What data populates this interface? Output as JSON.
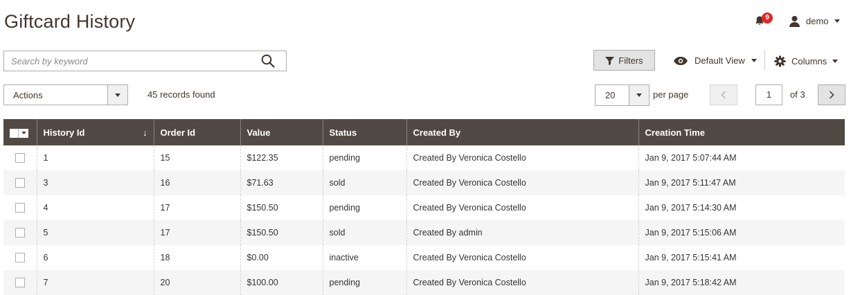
{
  "header": {
    "title": "Giftcard History",
    "notifications_count": "9",
    "user_name": "demo"
  },
  "search": {
    "placeholder": "Search by keyword",
    "value": ""
  },
  "toolbar": {
    "filters_label": "Filters",
    "view_label": "Default View",
    "columns_label": "Columns"
  },
  "actions": {
    "label": "Actions",
    "records_found": "45 records found"
  },
  "pagination": {
    "per_page_value": "20",
    "per_page_label": "per page",
    "current_page": "1",
    "total_pages_text": "of 3"
  },
  "icons": {
    "bell": "bell-icon",
    "user": "user-icon",
    "search": "search-icon",
    "filter": "funnel-icon",
    "view": "eye-icon",
    "columns": "gear-icon",
    "prev": "chevron-left-icon",
    "next": "chevron-right-icon"
  },
  "colors": {
    "header_bg": "#514943",
    "badge": "#e22626",
    "text": "#41362f"
  },
  "table": {
    "columns": [
      "History Id",
      "Order Id",
      "Value",
      "Status",
      "Created By",
      "Creation Time"
    ],
    "sort_indicator": "↓",
    "rows": [
      {
        "history_id": "1",
        "order_id": "15",
        "value": "$122.35",
        "status": "pending",
        "created_by": "Created By Veronica Costello",
        "creation_time": "Jan 9, 2017 5:07:44 AM"
      },
      {
        "history_id": "3",
        "order_id": "16",
        "value": "$71.63",
        "status": "sold",
        "created_by": "Created By Veronica Costello",
        "creation_time": "Jan 9, 2017 5:11:47 AM"
      },
      {
        "history_id": "4",
        "order_id": "17",
        "value": "$150.50",
        "status": "pending",
        "created_by": "Created By Veronica Costello",
        "creation_time": "Jan 9, 2017 5:14:30 AM"
      },
      {
        "history_id": "5",
        "order_id": "17",
        "value": "$150.50",
        "status": "sold",
        "created_by": "Created By admin",
        "creation_time": "Jan 9, 2017 5:15:06 AM"
      },
      {
        "history_id": "6",
        "order_id": "18",
        "value": "$0.00",
        "status": "inactive",
        "created_by": "Created By Veronica Costello",
        "creation_time": "Jan 9, 2017 5:15:41 AM"
      },
      {
        "history_id": "7",
        "order_id": "20",
        "value": "$100.00",
        "status": "pending",
        "created_by": "Created By Veronica Costello",
        "creation_time": "Jan 9, 2017 5:18:42 AM"
      }
    ]
  }
}
